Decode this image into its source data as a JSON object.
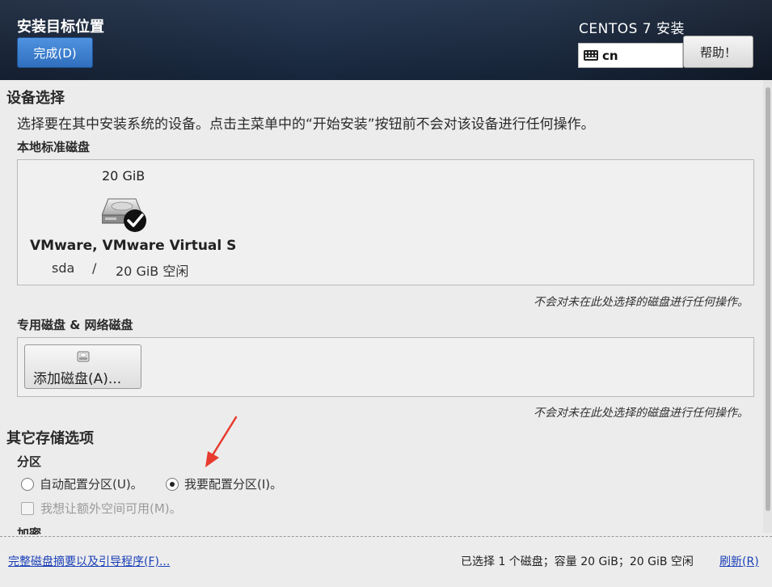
{
  "header": {
    "page_title": "安装目标位置",
    "done_label": "完成(D)",
    "product_title": "CENTOS 7 安装",
    "keyboard_layout": "cn",
    "help_label": "帮助！"
  },
  "device_selection": {
    "title": "设备选择",
    "description": "选择要在其中安装系统的设备。点击主菜单中的“开始安装”按钮前不会对该设备进行任何操作。",
    "local_disks_title": "本地标准磁盘",
    "disks": [
      {
        "size": "20 GiB",
        "name": "VMware, VMware Virtual S",
        "device": "sda",
        "separator": "/",
        "free": "20 GiB 空闲",
        "selected": true
      }
    ],
    "local_note": "不会对未在此处选择的磁盘进行任何操作。",
    "special_disks_title": "专用磁盘 & 网络磁盘",
    "add_disk_label": "添加磁盘(A)...",
    "special_note": "不会对未在此处选择的磁盘进行任何操作。"
  },
  "other_storage": {
    "title": "其它存储选项",
    "partition_title": "分区",
    "auto_partition_label": "自动配置分区(U)。",
    "manual_partition_label": "我要配置分区(I)。",
    "selected_partition": "manual",
    "extra_space_label": "我想让额外空间可用(M)。",
    "encryption_title": "加密"
  },
  "footer": {
    "summary_link": "完整磁盘摘要以及引导程序(F)...",
    "status": "已选择 1 个磁盘；容量 20 GiB；20 GiB 空闲",
    "refresh_link": "刷新(R)"
  },
  "colors": {
    "header_bg": "#1c2e49",
    "done_button": "#3b7fcf",
    "link": "#1a3fb8",
    "annotation_arrow": "#e83a2e"
  }
}
